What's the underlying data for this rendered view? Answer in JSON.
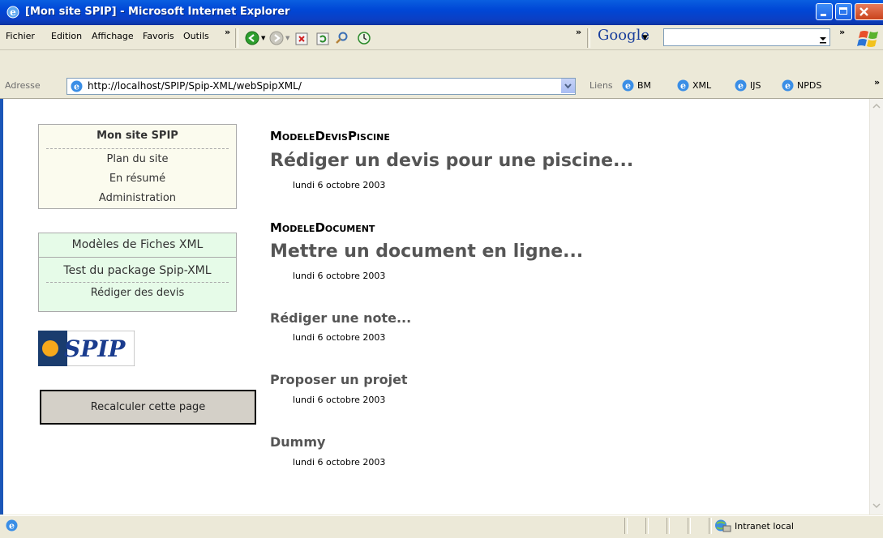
{
  "window": {
    "title": "[Mon site SPIP] - Microsoft Internet Explorer"
  },
  "menubar": {
    "items": [
      "Fichier",
      "Edition",
      "Affichage",
      "Favoris",
      "Outils"
    ],
    "google_label": "Google"
  },
  "address_bar": {
    "label": "Adresse",
    "url": "http://localhost/SPIP/Spip-XML/webSpipXML/",
    "links_label": "Liens",
    "links": [
      "BM",
      "XML",
      "IJS",
      "NPDS"
    ]
  },
  "sidebar": {
    "site_box": {
      "title": "Mon site SPIP",
      "items": [
        "Plan du site",
        "En résumé",
        "Administration"
      ]
    },
    "sections_box": {
      "items": [
        "Modèles de Fiches XML",
        "Test du package Spip-XML",
        "Rédiger des devis"
      ]
    },
    "logo_text": "SPIP",
    "recalc_label": "Recalculer cette page"
  },
  "main": {
    "entries": [
      {
        "rubrique": "ModeleDevisPiscine",
        "title": "Rédiger un devis pour une piscine...",
        "date": "lundi 6 octobre 2003"
      },
      {
        "rubrique": "ModeleDocument",
        "title": "Mettre un document en ligne...",
        "date": "lundi 6 octobre 2003"
      },
      {
        "rubrique": "",
        "title": "Rédiger une note...",
        "date": "lundi 6 octobre 2003"
      },
      {
        "rubrique": "",
        "title": "Proposer un projet",
        "date": "lundi 6 octobre 2003"
      },
      {
        "rubrique": "",
        "title": "Dummy",
        "date": "lundi 6 octobre 2003"
      }
    ]
  },
  "statusbar": {
    "zone": "Intranet local"
  }
}
